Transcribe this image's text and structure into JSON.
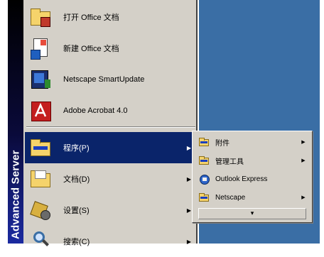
{
  "os_banner": {
    "text": "Advanced Server"
  },
  "start_menu": {
    "items": [
      {
        "label": "打开 Office 文档",
        "icon": "open-office-document-icon",
        "has_submenu": false
      },
      {
        "label": "新建 Office 文档",
        "icon": "new-office-document-icon",
        "has_submenu": false
      },
      {
        "label": "Netscape SmartUpdate",
        "icon": "netscape-smartupdate-icon",
        "has_submenu": false
      },
      {
        "label": "Adobe Acrobat 4.0",
        "icon": "adobe-acrobat-icon",
        "has_submenu": false
      },
      {
        "label": "程序(P)",
        "icon": "programs-folder-icon",
        "has_submenu": true,
        "selected": true
      },
      {
        "label": "文档(D)",
        "icon": "documents-folder-icon",
        "has_submenu": true
      },
      {
        "label": "设置(S)",
        "icon": "settings-icon",
        "has_submenu": true
      },
      {
        "label": "搜索(C)",
        "icon": "search-icon",
        "has_submenu": true
      }
    ]
  },
  "submenu": {
    "items": [
      {
        "label": "附件",
        "icon": "accessories-folder-icon",
        "has_submenu": true
      },
      {
        "label": "管理工具",
        "icon": "admin-tools-folder-icon",
        "has_submenu": true
      },
      {
        "label": "Outlook Express",
        "icon": "outlook-express-icon",
        "has_submenu": false
      },
      {
        "label": "Netscape",
        "icon": "netscape-folder-icon",
        "has_submenu": true
      }
    ],
    "expand_glyph": "▾"
  },
  "glyphs": {
    "submenu_arrow": "▶"
  },
  "colors": {
    "menu_bg": "#d4d0c8",
    "selection": "#0a246a",
    "desktop": "#3a6ea5"
  }
}
